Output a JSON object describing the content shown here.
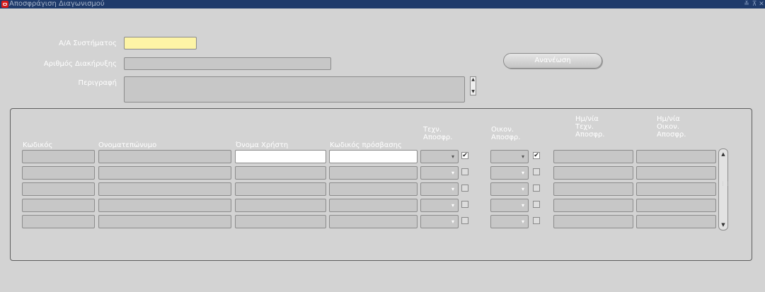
{
  "window": {
    "title": "Αποσφράγιση Διαγωνισμού",
    "controls": {
      "minimize": "≚",
      "restore": "⊼",
      "close": "✕"
    }
  },
  "form": {
    "system_id_label": "Α/Α Συστήματος",
    "system_id_value": "",
    "announcement_label": "Αριθμός Διακήρυξης",
    "announcement_value": "",
    "description_label": "Περιγραφή",
    "description_value": "",
    "refresh_button": "Ανανέωση"
  },
  "table": {
    "headers": {
      "code": "Κωδικός",
      "fullname": "Ονοματεπώνυμο",
      "username": "Όνομα Χρήστη",
      "password": "Κωδικός πρόσβασης",
      "tech_unseal": "Τεχν.\nΑποσφρ.",
      "fin_unseal": "Οικον.\nΑποσφρ.",
      "tech_date": "Ημ/νία\nΤεχν.\nΑποσφρ.",
      "fin_date": "Ημ/νία\nΟικον.\nΑποσφρ."
    },
    "rows": [
      {
        "code": "",
        "fullname": "",
        "username": "",
        "password": "",
        "tech_checked": true,
        "fin_checked": true,
        "tech_date": "",
        "fin_date": ""
      },
      {
        "code": "",
        "fullname": "",
        "username": "",
        "password": "",
        "tech_checked": false,
        "fin_checked": false,
        "tech_date": "",
        "fin_date": ""
      },
      {
        "code": "",
        "fullname": "",
        "username": "",
        "password": "",
        "tech_checked": false,
        "fin_checked": false,
        "tech_date": "",
        "fin_date": ""
      },
      {
        "code": "",
        "fullname": "",
        "username": "",
        "password": "",
        "tech_checked": false,
        "fin_checked": false,
        "tech_date": "",
        "fin_date": ""
      },
      {
        "code": "",
        "fullname": "",
        "username": "",
        "password": "",
        "tech_checked": false,
        "fin_checked": false,
        "tech_date": "",
        "fin_date": ""
      }
    ]
  },
  "icons": {
    "dropdown": "▾",
    "check": "✔",
    "scroll_up": "▲",
    "scroll_down": "▼",
    "grip": "⋮⋮"
  }
}
